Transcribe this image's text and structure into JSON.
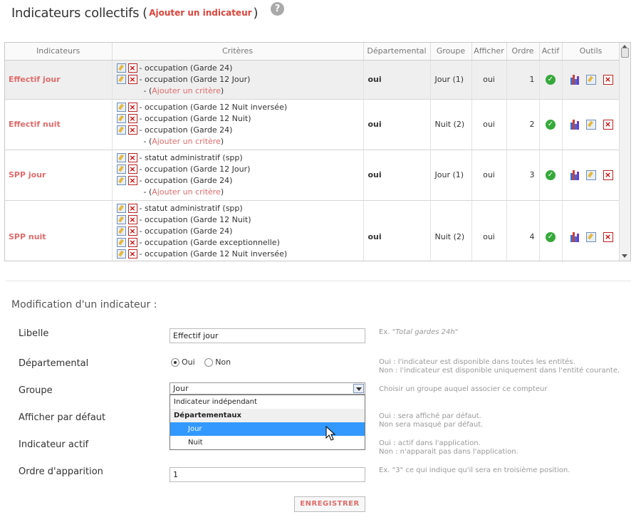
{
  "header": {
    "title": "Indicateurs collectifs",
    "paren_open": "(",
    "add_link": "Ajouter un indicateur",
    "paren_close": ")",
    "help_glyph": "?"
  },
  "table": {
    "columns": [
      "Indicateurs",
      "Critères",
      "Départemental",
      "Groupe",
      "Afficher",
      "Ordre",
      "Actif",
      "Outils"
    ],
    "add_criteria_label": "Ajouter un critère",
    "add_prefix": "- (",
    "add_suffix": ")",
    "rows": [
      {
        "name": "Effectif jour",
        "criteria": [
          "- occupation (Garde 24)",
          "- occupation (Garde 12 Jour)"
        ],
        "dept": "oui",
        "group": "Jour (1)",
        "show": "oui",
        "order": "1"
      },
      {
        "name": "Effectif nuit",
        "criteria": [
          "- occupation (Garde 12 Nuit inversée)",
          "- occupation (Garde 12 Nuit)",
          "- occupation (Garde 24)"
        ],
        "dept": "oui",
        "group": "Nuit (2)",
        "show": "oui",
        "order": "2"
      },
      {
        "name": "SPP jour",
        "criteria": [
          "- statut administratif (spp)",
          "- occupation (Garde 12 Jour)",
          "- occupation (Garde 24)"
        ],
        "dept": "oui",
        "group": "Jour (1)",
        "show": "oui",
        "order": "3"
      },
      {
        "name": "SPP nuit",
        "criteria": [
          "- statut administratif (spp)",
          "- occupation (Garde 12 Nuit)",
          "- occupation (Garde 24)",
          "- occupation (Garde exceptionnelle)",
          "- occupation (Garde 12 Nuit inversée)"
        ],
        "dept": "oui",
        "group": "Nuit (2)",
        "show": "oui",
        "order": "4"
      }
    ]
  },
  "form": {
    "title": "Modification d'un indicateur :",
    "libelle_label": "Libelle",
    "libelle_value": "Effectif jour",
    "libelle_hint_prefix": "Ex. \"",
    "libelle_hint_example": "Total gardes 24h",
    "libelle_hint_suffix": "\"",
    "dept_label": "Départemental",
    "dept_yes": "Oui",
    "dept_no": "Non",
    "dept_hint_1": "Oui : l'indicateur est disponible dans toutes les entités.",
    "dept_hint_2": "Non : l'indicateur est disponible uniquement dans l'entité courante.",
    "group_label": "Groupe",
    "group_value": "Jour",
    "group_hint": "Choisir un groupe auquel associer ce compteur",
    "group_options": {
      "independent": "Indicateur indépendant",
      "group_header": "Départementaux",
      "jour": "Jour",
      "nuit": "Nuit"
    },
    "show_label": "Afficher par défaut",
    "show_hint_1": "Oui : sera affiché par défaut.",
    "show_hint_2": "Non sera masqué par défaut.",
    "active_label": "Indicateur actif",
    "active_hint_1": "Oui : actif dans l'application.",
    "active_hint_2": "Non : n'apparait pas dans l'application.",
    "order_label": "Ordre d'apparition",
    "order_value": "1",
    "order_hint": "Ex. \"3\" ce qui indique qu'il sera en troisième position.",
    "save_label": "ENREGISTRER"
  },
  "colors": {
    "accent": "#e06c6c",
    "active_green": "#36a93a",
    "selection": "#3399ff"
  }
}
